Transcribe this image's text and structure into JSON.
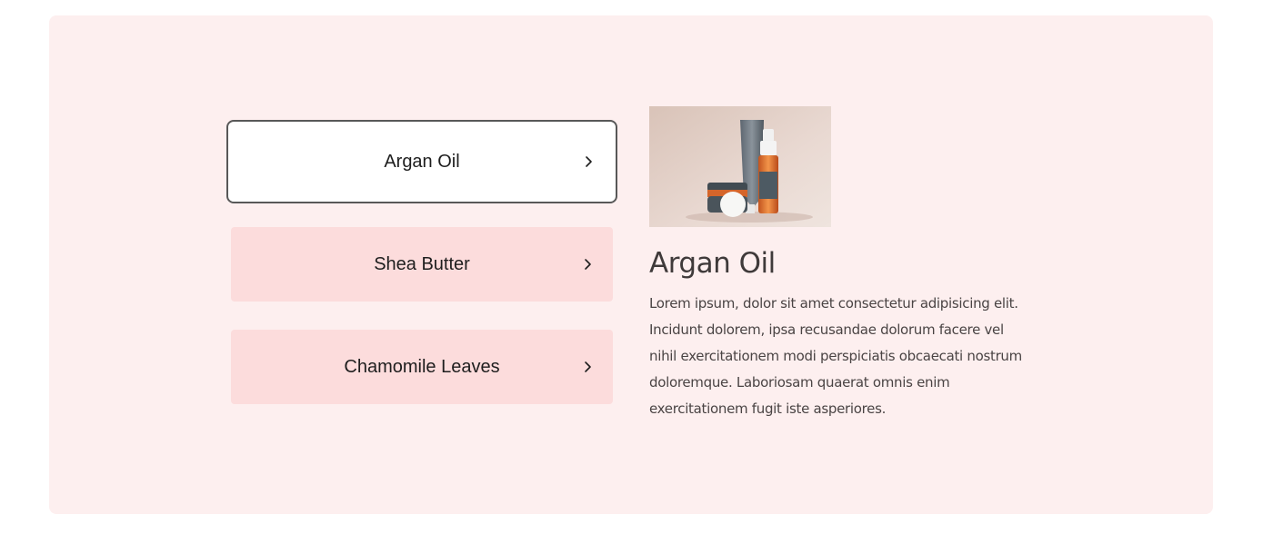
{
  "tabs": [
    {
      "label": "Argan Oil",
      "active": true
    },
    {
      "label": "Shea Butter",
      "active": false
    },
    {
      "label": "Chamomile Leaves",
      "active": false
    }
  ],
  "detail": {
    "title": "Argan Oil",
    "description": "Lorem ipsum, dolor sit amet consectetur adipisicing elit. Incidunt dolorem, ipsa recusandae dolorum facere vel nihil exercitationem modi perspiciatis obcaecati nostrum doloremque. Laboriosam quaerat omnis enim exercitationem fugit iste asperiores."
  },
  "icons": {
    "chevron": "chevron-right-icon",
    "image": "product-image"
  },
  "colors": {
    "panel_bg": "#fdefef",
    "tab_bg": "#fcdcdc",
    "active_tab_bg": "#ffffff",
    "active_border": "#585858",
    "text": "#1e1e1e"
  }
}
